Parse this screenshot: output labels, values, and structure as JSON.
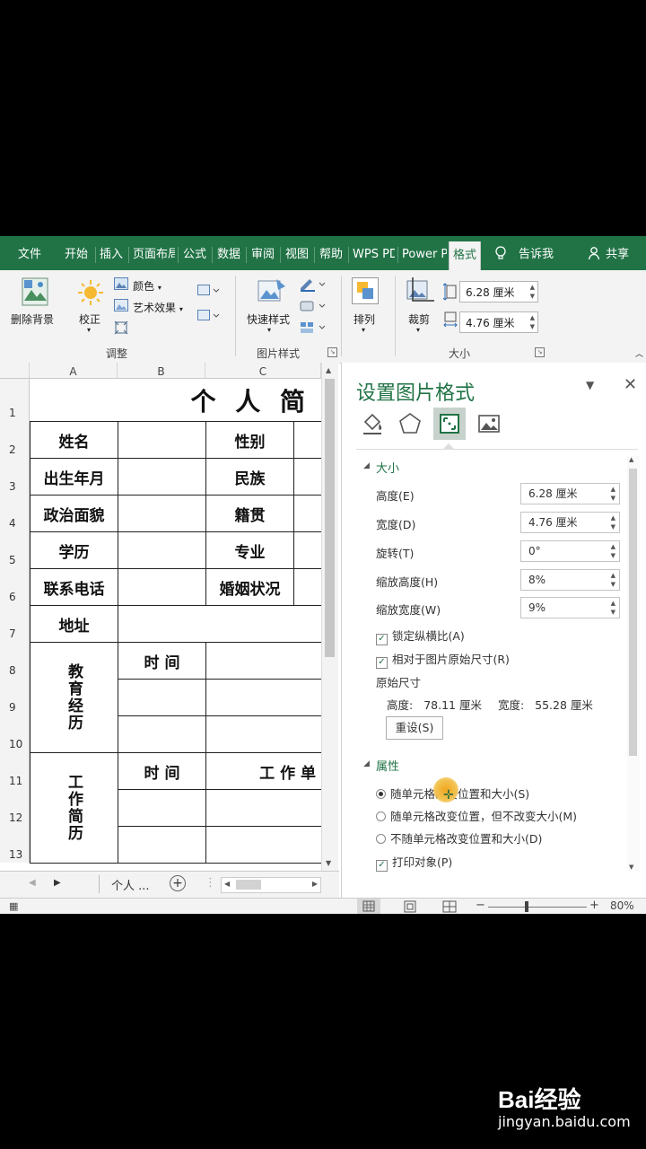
{
  "tabs": [
    "文件",
    "开始",
    "插入",
    "页面布局",
    "公式",
    "数据",
    "审阅",
    "视图",
    "帮助",
    "WPS PDF",
    "Power Pivot",
    "格式",
    "告诉我",
    "共享"
  ],
  "ribbon": {
    "remove_bg": "删除背景",
    "correct": "校正",
    "color": "颜色",
    "art_effect": "艺术效果",
    "adjust_group": "调整",
    "quick_style": "快速样式",
    "pic_style_group": "图片样式",
    "arrange": "排列",
    "crop": "裁剪",
    "height_value": "6.28 厘米",
    "width_value": "4.76 厘米",
    "size_group": "大小"
  },
  "sheet": {
    "columns": [
      "A",
      "B",
      "C"
    ],
    "rows": [
      "1",
      "2",
      "3",
      "4",
      "5",
      "6",
      "7",
      "8",
      "9",
      "10",
      "11",
      "12",
      "13"
    ],
    "title": "个 人 简",
    "labels": {
      "name": "姓名",
      "gender": "性别",
      "birth": "出生年月",
      "ethnic": "民族",
      "political": "政治面貌",
      "native": "籍贯",
      "education": "学历",
      "major": "专业",
      "phone": "联系电话",
      "marital": "婚姻状况",
      "address": "地址",
      "edu_history": "教育经历",
      "time1": "时 间",
      "work_history": "工作简历",
      "time2": "时 间",
      "work_unit": "工 作 单"
    },
    "sheet_tab": "个人 ..."
  },
  "pane": {
    "title": "设置图片格式",
    "section_size": "大小",
    "height_label": "高度(E)",
    "height_value": "6.28 厘米",
    "width_label": "宽度(D)",
    "width_value": "4.76 厘米",
    "rotation_label": "旋转(T)",
    "rotation_value": "0°",
    "scale_h_label": "缩放高度(H)",
    "scale_h_value": "8%",
    "scale_w_label": "缩放宽度(W)",
    "scale_w_value": "9%",
    "lock_ratio": "锁定纵横比(A)",
    "relative_original": "相对于图片原始尺寸(R)",
    "original_size": "原始尺寸",
    "orig_h_label": "高度:",
    "orig_h_value": "78.11 厘米",
    "orig_w_label": "宽度:",
    "orig_w_value": "55.28 厘米",
    "reset": "重设(S)",
    "section_props": "属性",
    "opt1": "随单元格改变位置和大小(S)",
    "opt2": "随单元格改变位置，但不改变大小(M)",
    "opt3": "不随单元格改变位置和大小(D)",
    "print_obj": "打印对象(P)"
  },
  "status": {
    "zoom": "80%"
  },
  "watermark": {
    "brand": "Bai经验",
    "url": "jingyan.baidu.com"
  },
  "colors": {
    "accent": "#217346",
    "pane_title": "#217346"
  }
}
